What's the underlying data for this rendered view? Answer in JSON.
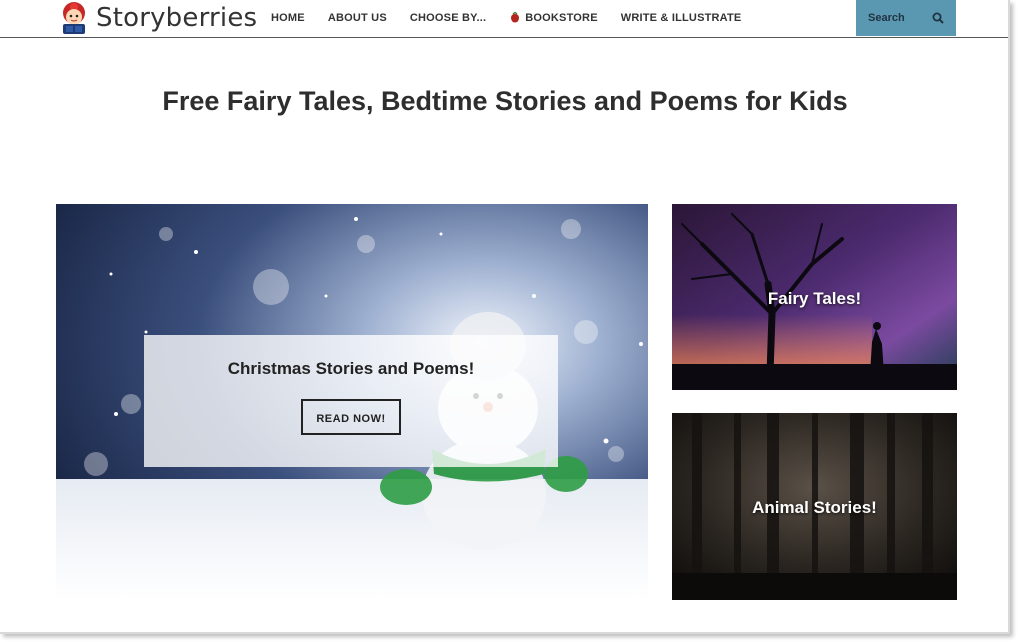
{
  "site": {
    "brand": "Storyberries"
  },
  "nav": {
    "items": [
      {
        "label": "HOME"
      },
      {
        "label": "ABOUT US"
      },
      {
        "label": "CHOOSE BY..."
      },
      {
        "label": "BOOKSTORE",
        "icon": "strawberry-icon"
      },
      {
        "label": "WRITE & ILLUSTRATE"
      }
    ],
    "search_label": "Search",
    "search_icon": "search-icon"
  },
  "page": {
    "title": "Free Fairy Tales, Bedtime Stories and Poems for Kids"
  },
  "hero": {
    "title": "Christmas Stories and Poems!",
    "button_label": "READ NOW!"
  },
  "tiles": [
    {
      "label": "Fairy Tales!"
    },
    {
      "label": "Animal Stories!"
    }
  ],
  "colors": {
    "search_bg": "#5a97b0",
    "text_dark": "#2e2e2e"
  }
}
